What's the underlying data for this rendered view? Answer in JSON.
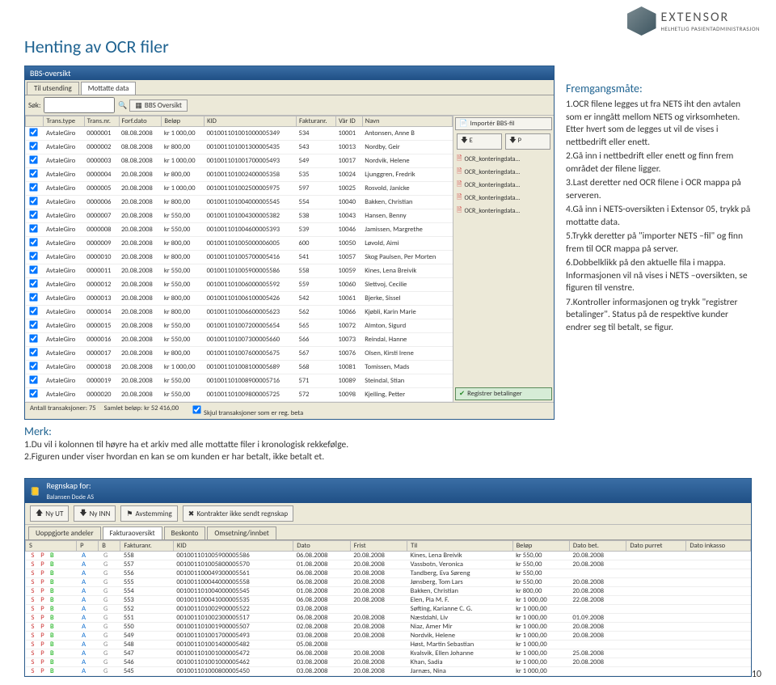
{
  "header": {
    "logo_name": "EXTENSOR",
    "logo_tagline": "HELHETLIG PASIENTADMINISTRASJON"
  },
  "title": "Henting av OCR filer",
  "bbs": {
    "window_title": "BBS-oversikt",
    "tabs": [
      "Til utsending",
      "Mottatte data"
    ],
    "toolbar": {
      "search_label": "Søk:",
      "search_placeholder": "",
      "oversikt": "BBS Oversikt"
    },
    "columns": [
      "",
      "Trans.type",
      "Trans.nr.",
      "Forf.dato",
      "Beløp",
      "KID",
      "Fakturanr.",
      "Vår ID",
      "Navn"
    ],
    "rows": [
      [
        "AvtaleGiro",
        "0000001",
        "08.08.2008",
        "kr 1 000,00",
        "001001101001000005349",
        "534",
        "10001",
        "Antonsen, Anne B"
      ],
      [
        "AvtaleGiro",
        "0000002",
        "08.08.2008",
        "kr 800,00",
        "001001101001300005435",
        "543",
        "10013",
        "Nordby, Geir"
      ],
      [
        "AvtaleGiro",
        "0000003",
        "08.08.2008",
        "kr 1 000,00",
        "001001101001700005493",
        "549",
        "10017",
        "Nordvik, Helene"
      ],
      [
        "AvtaleGiro",
        "0000004",
        "20.08.2008",
        "kr 800,00",
        "001001101002400005358",
        "535",
        "10024",
        "Ljunggren, Fredrik"
      ],
      [
        "AvtaleGiro",
        "0000005",
        "20.08.2008",
        "kr 1 000,00",
        "001001101002500005975",
        "597",
        "10025",
        "Rosvold, Janicke"
      ],
      [
        "AvtaleGiro",
        "0000006",
        "20.08.2008",
        "kr 800,00",
        "001001101004000005545",
        "554",
        "10040",
        "Bakken, Christian"
      ],
      [
        "AvtaleGiro",
        "0000007",
        "20.08.2008",
        "kr 550,00",
        "001001101004300005382",
        "538",
        "10043",
        "Hansen, Benny"
      ],
      [
        "AvtaleGiro",
        "0000008",
        "20.08.2008",
        "kr 550,00",
        "001001101004600005393",
        "539",
        "10046",
        "Jamissen, Margrethe"
      ],
      [
        "AvtaleGiro",
        "0000009",
        "20.08.2008",
        "kr 800,00",
        "001001101005000006005",
        "600",
        "10050",
        "Løvold, Aimi"
      ],
      [
        "AvtaleGiro",
        "0000010",
        "20.08.2008",
        "kr 800,00",
        "001001101005700005416",
        "541",
        "10057",
        "Skog Paulsen, Per Morten"
      ],
      [
        "AvtaleGiro",
        "0000011",
        "20.08.2008",
        "kr 550,00",
        "001001101005900005586",
        "558",
        "10059",
        "Kines, Lena Breivik"
      ],
      [
        "AvtaleGiro",
        "0000012",
        "20.08.2008",
        "kr 550,00",
        "001001101006000005592",
        "559",
        "10060",
        "Slettvoj, Cecilie"
      ],
      [
        "AvtaleGiro",
        "0000013",
        "20.08.2008",
        "kr 800,00",
        "001001101006100005426",
        "542",
        "10061",
        "Bjerke, Sissel"
      ],
      [
        "AvtaleGiro",
        "0000014",
        "20.08.2008",
        "kr 800,00",
        "001001101006600005623",
        "562",
        "10066",
        "Kjøbli, Karin Marie"
      ],
      [
        "AvtaleGiro",
        "0000015",
        "20.08.2008",
        "kr 550,00",
        "001001101007200005654",
        "565",
        "10072",
        "Almton, Sigurd"
      ],
      [
        "AvtaleGiro",
        "0000016",
        "20.08.2008",
        "kr 550,00",
        "001001101007300005660",
        "566",
        "10073",
        "Reindal, Hanne"
      ],
      [
        "AvtaleGiro",
        "0000017",
        "20.08.2008",
        "kr 800,00",
        "001001101007600005675",
        "567",
        "10076",
        "Olsen, Kirsti Irene"
      ],
      [
        "AvtaleGiro",
        "0000018",
        "20.08.2008",
        "kr 1 000,00",
        "001001101008100005689",
        "568",
        "10081",
        "Tomissen, Mads"
      ],
      [
        "AvtaleGiro",
        "0000019",
        "20.08.2008",
        "kr 550,00",
        "001001101008900005716",
        "571",
        "10089",
        "Steindal, Stian"
      ],
      [
        "AvtaleGiro",
        "0000020",
        "20.08.2008",
        "kr 550,00",
        "001001101009800005725",
        "572",
        "10098",
        "Kjelling, Petter"
      ]
    ],
    "side": {
      "import": "Importér BBS-fil",
      "btn_e": "🡇 E",
      "btn_p": "🡇 P",
      "files": [
        "OCR_konteringdata…",
        "OCR_konteringdata…",
        "OCR_konteringdata…",
        "OCR_konteringdata…",
        "OCR_konteringdata…"
      ],
      "registrer": "Registrer betalinger"
    },
    "status": {
      "count": "Antall transaksjoner: 75",
      "sum": "Samlet beløp: kr 52 416,00",
      "skjul": "Skjul transaksjoner som er reg. beta"
    }
  },
  "merk": {
    "title": "Merk:",
    "lines": [
      "1.Du vil i kolonnen til høyre ha et arkiv med alle mottatte filer i kronologisk rekkefølge.",
      "2.Figuren under viser hvordan en kan se om kunden er har betalt, ikke betalt et."
    ]
  },
  "steps": {
    "title": "Fremgangsmåte:",
    "lines": [
      "1.OCR filene legges ut fra NETS iht den avtalen som er inngått mellom NETS og virksomheten. Etter hvert som de legges ut vil de vises i nettbedrift eller enett.",
      "2.Gå inn i nettbedrift eller enett og finn frem området der filene ligger.",
      "3.Last deretter ned OCR filene i OCR mappa på serveren.",
      "4.Gå inn i NETS-oversikten i Extensor 05, trykk på mottatte data.",
      "5.Trykk deretter på \"importer NETS –fil\" og finn frem til OCR mappa på server.",
      "6.Dobbelklikk på den aktuelle fila i mappa. Informasjonen vil nå vises i NETS –oversikten, se figuren til venstre.",
      "7.Kontroller informasjonen og trykk \"registrer betalinger\". Status på de respektive kunder endrer seg til betalt, se figur."
    ]
  },
  "reg": {
    "title": "Regnskap for:",
    "subtitle": "Balansen Dode AS",
    "toolbar": {
      "ny_ut": "Ny UT",
      "ny_inn": "Ny INN",
      "avstemming": "Avstemming",
      "kontrakter": "Kontrakter ikke sendt regnskap"
    },
    "tabs": [
      "Uoppgjorte andeler",
      "Fakturaoversikt",
      "Beskonto",
      "Omsetning/innbet"
    ],
    "columns": [
      "S",
      "P",
      "B",
      "Fakturanr.",
      "KID",
      "Dato",
      "Frist",
      "Til",
      "Beløp",
      "Dato bet.",
      "Dato purret",
      "Dato inkasso"
    ],
    "rows": [
      [
        "A",
        "G",
        "558",
        "001001101005900005586",
        "06.08.2008",
        "20.08.2008",
        "Kines, Lena Breivik",
        "kr 550,00",
        "20.08.2008",
        "",
        ""
      ],
      [
        "A",
        "G",
        "557",
        "001001101005800005570",
        "01.08.2008",
        "20.08.2008",
        "Vassbotn, Veronica",
        "kr 550,00",
        "20.08.2008",
        "",
        ""
      ],
      [
        "A",
        "G",
        "556",
        "001001100049300005561",
        "06.08.2008",
        "20.08.2008",
        "Tandberg, Eva Søreng",
        "kr 550,00",
        "",
        "",
        ""
      ],
      [
        "A",
        "G",
        "555",
        "001001100044000005558",
        "06.08.2008",
        "20.08.2008",
        "Jønsberg, Tom Lars",
        "kr 550,00",
        "20.08.2008",
        "",
        ""
      ],
      [
        "A",
        "G",
        "554",
        "001001101004000005545",
        "01.08.2008",
        "20.08.2008",
        "Bakken, Christian",
        "kr 800,00",
        "20.08.2008",
        "",
        ""
      ],
      [
        "A",
        "G",
        "553",
        "001001100041000005535",
        "06.08.2008",
        "20.08.2008",
        "Elen, Pia M. F.",
        "kr 1 000,00",
        "22.08.2008",
        "",
        ""
      ],
      [
        "A",
        "G",
        "552",
        "001001101002900005522",
        "03.08.2008",
        "",
        "Søfting, Karianne C. G.",
        "kr 1 000,00",
        "",
        "",
        ""
      ],
      [
        "A",
        "G",
        "551",
        "001001101002300005517",
        "06.08.2008",
        "20.08.2008",
        "Næstdahl, Liv",
        "kr 1 000,00",
        "01.09.2008",
        "",
        ""
      ],
      [
        "A",
        "G",
        "550",
        "001001101001900005507",
        "02.08.2008",
        "20.08.2008",
        "Niaz, Amer Mir",
        "kr 1 000,00",
        "20.08.2008",
        "",
        ""
      ],
      [
        "A",
        "G",
        "549",
        "001001101001700005493",
        "03.08.2008",
        "20.08.2008",
        "Nordvik, Helene",
        "kr 1 000,00",
        "20.08.2008",
        "",
        ""
      ],
      [
        "A",
        "G",
        "548",
        "001001101001400005482",
        "05.08.2008",
        "",
        "Høst, Martin Sebastian",
        "kr 1 000,00",
        "",
        "",
        ""
      ],
      [
        "A",
        "G",
        "547",
        "001001101001000005472",
        "06.08.2008",
        "20.08.2008",
        "Kvalsvik, Ellen Johanne",
        "kr 1 000,00",
        "25.08.2008",
        "",
        ""
      ],
      [
        "A",
        "G",
        "546",
        "001001101001000005462",
        "03.08.2008",
        "20.08.2008",
        "Khan, Sadia",
        "kr 1 000,00",
        "20.08.2008",
        "",
        ""
      ],
      [
        "A",
        "G",
        "545",
        "001001101000800005450",
        "03.08.2008",
        "20.08.2008",
        "Jarnæs, Nina",
        "kr 1 000,00",
        "",
        "",
        ""
      ]
    ]
  },
  "page_number": "10"
}
